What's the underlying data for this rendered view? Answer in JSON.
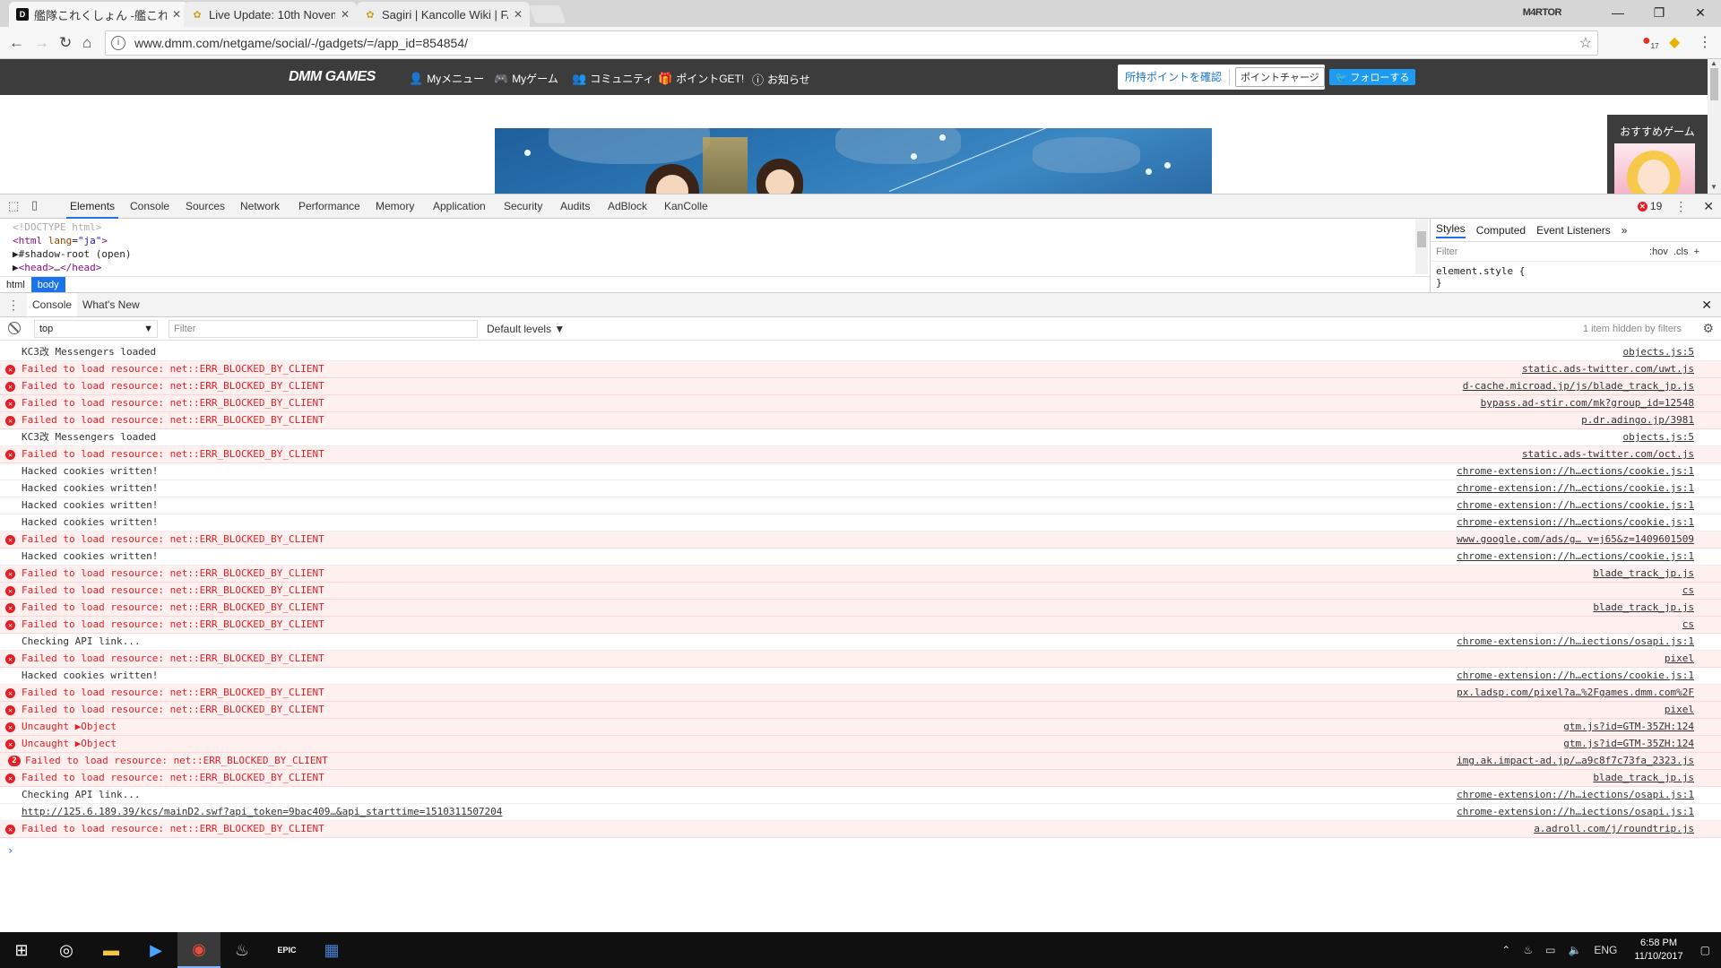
{
  "browser": {
    "tabs": [
      {
        "title": "艦隊これくしょん -艦これ- -",
        "favicon": "dmm-icon",
        "active": true
      },
      {
        "title": "Live Update: 10th Novem",
        "favicon": "kancolle-wiki-icon",
        "active": false
      },
      {
        "title": "Sagiri | Kancolle Wiki | FA",
        "favicon": "kancolle-wiki-icon",
        "active": false
      }
    ],
    "profile_name": "M4RTOR",
    "url": "www.dmm.com/netgame/social/-/gadgets/=/app_id=854854/",
    "extension_badge": "17"
  },
  "dmm_header": {
    "logo": "DMM GAMES",
    "nav": [
      "Myメニュー",
      "Myゲーム",
      "コミュニティ",
      "ポイントGET!",
      "お知らせ"
    ],
    "points_check": "所持ポイントを確認",
    "points_charge": "ポイントチャージ",
    "follow": "フォローする"
  },
  "recommend": {
    "title": "おすすめゲーム"
  },
  "devtools": {
    "tabs": [
      "Elements",
      "Console",
      "Sources",
      "Network",
      "Performance",
      "Memory",
      "Application",
      "Security",
      "Audits",
      "AdBlock",
      "KanColle"
    ],
    "active_tab": "Elements",
    "error_count": "19",
    "elements": {
      "doctype": "<!DOCTYPE html>",
      "html_open_tag": "html",
      "html_attr": "lang",
      "html_attr_val": "\"ja\"",
      "shadow": "#shadow-root (open)",
      "head_tag": "<head>",
      "head_ellipsis": "…",
      "head_close": "</head>"
    },
    "breadcrumbs": [
      "html",
      "body"
    ],
    "styles_tabs": [
      "Styles",
      "Computed",
      "Event Listeners"
    ],
    "styles_filter": "Filter",
    "styles_hov": ":hov",
    "styles_cls": ".cls",
    "element_style": "element.style {",
    "element_style_close": "}"
  },
  "drawer": {
    "tabs": [
      "Console",
      "What's New"
    ]
  },
  "console": {
    "context": "top",
    "filter_placeholder": "Filter",
    "levels": "Default levels",
    "hidden_info": "1 item hidden by filters",
    "messages": [
      {
        "level": "info",
        "text": "KC3改 Messengers loaded",
        "source": "objects.js:5"
      },
      {
        "level": "error",
        "text": "Failed to load resource: net::ERR_BLOCKED_BY_CLIENT",
        "source": "static.ads-twitter.com/uwt.js"
      },
      {
        "level": "error",
        "text": "Failed to load resource: net::ERR_BLOCKED_BY_CLIENT",
        "source": "d-cache.microad.jp/js/blade_track_jp.js"
      },
      {
        "level": "error",
        "text": "Failed to load resource: net::ERR_BLOCKED_BY_CLIENT",
        "source": "bypass.ad-stir.com/mk?group_id=12548"
      },
      {
        "level": "error",
        "text": "Failed to load resource: net::ERR_BLOCKED_BY_CLIENT",
        "source": "p.dr.adingo.jp/3981"
      },
      {
        "level": "info",
        "text": "KC3改 Messengers loaded",
        "source": "objects.js:5"
      },
      {
        "level": "error",
        "text": "Failed to load resource: net::ERR_BLOCKED_BY_CLIENT",
        "source": "static.ads-twitter.com/oct.js"
      },
      {
        "level": "info",
        "text": "Hacked cookies written!",
        "source": "chrome-extension://h…ections/cookie.js:1"
      },
      {
        "level": "info",
        "text": "Hacked cookies written!",
        "source": "chrome-extension://h…ections/cookie.js:1"
      },
      {
        "level": "info",
        "text": "Hacked cookies written!",
        "source": "chrome-extension://h…ections/cookie.js:1"
      },
      {
        "level": "info",
        "text": "Hacked cookies written!",
        "source": "chrome-extension://h…ections/cookie.js:1"
      },
      {
        "level": "error",
        "text": "Failed to load resource: net::ERR_BLOCKED_BY_CLIENT",
        "source": "www.google.com/ads/g… v=j65&z=1409601509"
      },
      {
        "level": "info",
        "text": "Hacked cookies written!",
        "source": "chrome-extension://h…ections/cookie.js:1"
      },
      {
        "level": "error",
        "text": "Failed to load resource: net::ERR_BLOCKED_BY_CLIENT",
        "source": "blade_track_jp.js"
      },
      {
        "level": "error",
        "text": "Failed to load resource: net::ERR_BLOCKED_BY_CLIENT",
        "source": "cs"
      },
      {
        "level": "error",
        "text": "Failed to load resource: net::ERR_BLOCKED_BY_CLIENT",
        "source": "blade_track_jp.js"
      },
      {
        "level": "error",
        "text": "Failed to load resource: net::ERR_BLOCKED_BY_CLIENT",
        "source": "cs"
      },
      {
        "level": "info",
        "text": "Checking API link...",
        "source": "chrome-extension://h…iections/osapi.js:1"
      },
      {
        "level": "error",
        "text": "Failed to load resource: net::ERR_BLOCKED_BY_CLIENT",
        "source": "pixel"
      },
      {
        "level": "info",
        "text": "Hacked cookies written!",
        "source": "chrome-extension://h…ections/cookie.js:1"
      },
      {
        "level": "error",
        "text": "Failed to load resource: net::ERR_BLOCKED_BY_CLIENT",
        "source": "px.ladsp.com/pixel?a…%2Fgames.dmm.com%2F"
      },
      {
        "level": "error",
        "text": "Failed to load resource: net::ERR_BLOCKED_BY_CLIENT",
        "source": "pixel"
      },
      {
        "level": "error",
        "text": "Uncaught ▶Object",
        "source": "gtm.js?id=GTM-35ZH:124"
      },
      {
        "level": "error",
        "text": "Uncaught ▶Object",
        "source": "gtm.js?id=GTM-35ZH:124"
      },
      {
        "level": "error",
        "text": "Failed to load resource: net::ERR_BLOCKED_BY_CLIENT",
        "source": "img.ak.impact-ad.jp/…a9c8f7c73fa_2323.js",
        "count": "2"
      },
      {
        "level": "error",
        "text": "Failed to load resource: net::ERR_BLOCKED_BY_CLIENT",
        "source": "blade_track_jp.js"
      },
      {
        "level": "info",
        "text": "Checking API link...",
        "source": "chrome-extension://h…iections/osapi.js:1"
      },
      {
        "level": "link",
        "text": "http://125.6.189.39/kcs/mainD2.swf?api_token=9bac409…&api_starttime=1510311507204",
        "source": "chrome-extension://h…iections/osapi.js:1"
      },
      {
        "level": "error",
        "text": "Failed to load resource: net::ERR_BLOCKED_BY_CLIENT",
        "source": "a.adroll.com/j/roundtrip.js"
      }
    ],
    "prompt": "›"
  },
  "taskbar": {
    "language": "ENG",
    "time": "6:58 PM",
    "date": "11/10/2017",
    "apps": [
      "windows-start-icon",
      "cortana-icon",
      "file-explorer-icon",
      "media-player-icon",
      "chrome-icon",
      "steam-icon",
      "epic-games-icon",
      "app-icon"
    ],
    "epic_label": "EPIC"
  },
  "colors": {
    "error_red": "#e41e25",
    "error_bg": "#fff0f0",
    "accent_blue": "#1a73e8",
    "dmm_dark": "#3c3c3c",
    "twitter_blue": "#1d9bf0"
  }
}
